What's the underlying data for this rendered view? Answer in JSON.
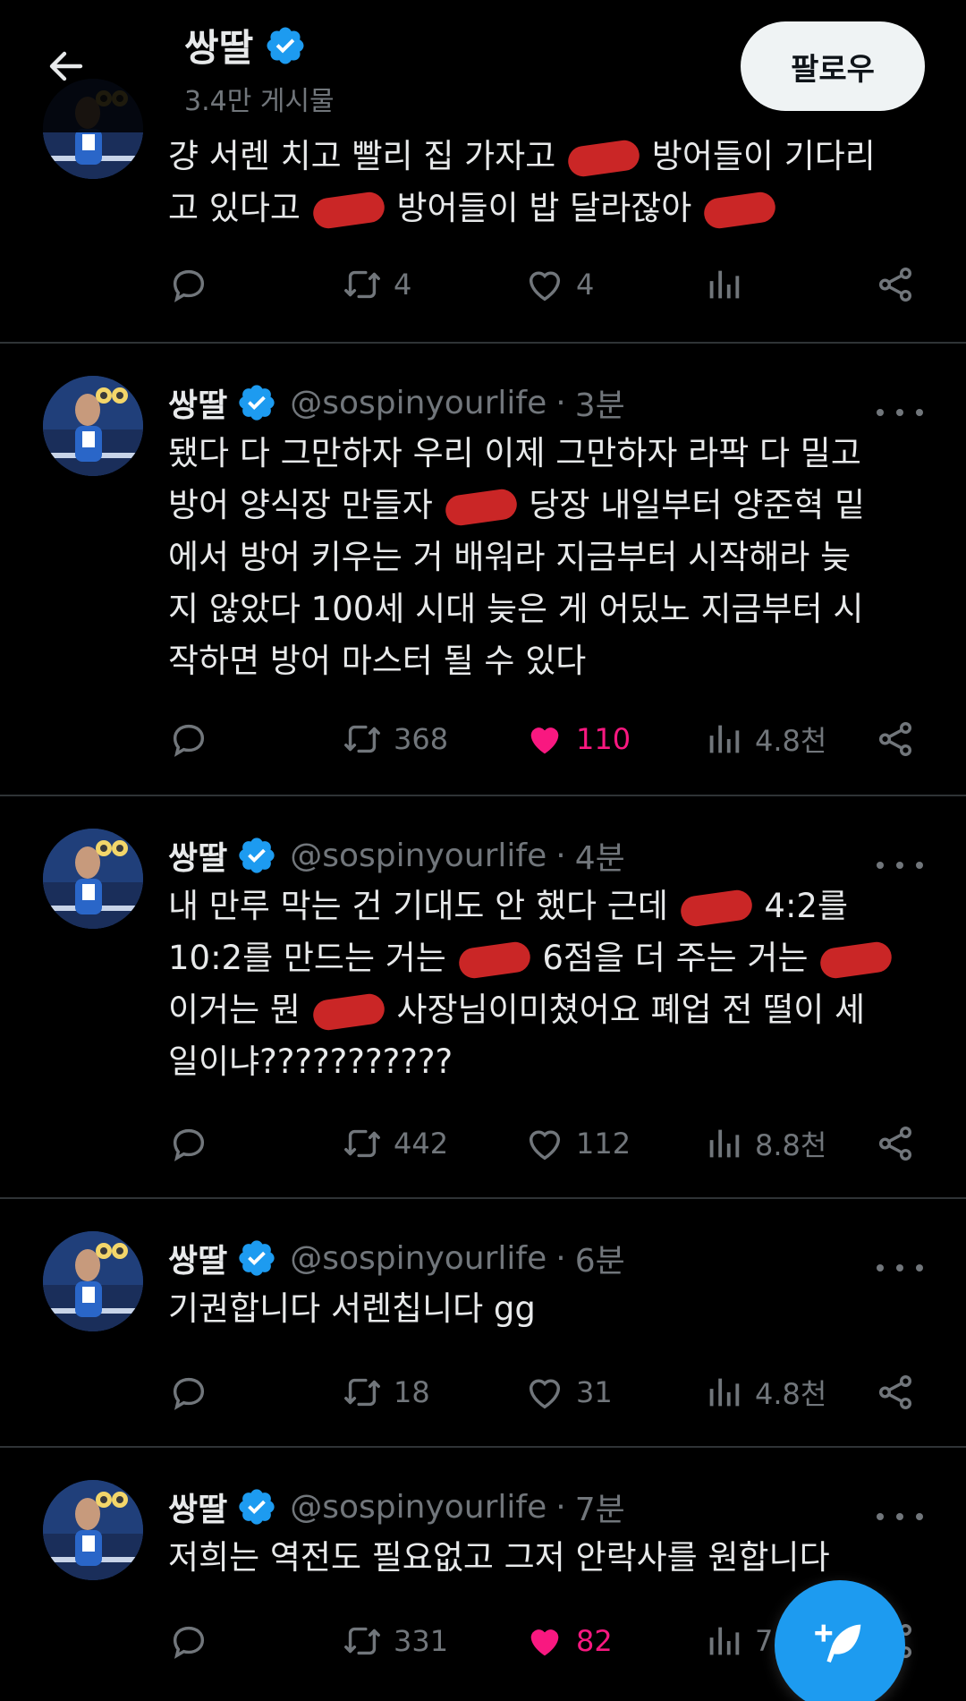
{
  "header": {
    "back_label": "←",
    "name": "쌍딸",
    "post_count": "3.4만 게시물",
    "follow_label": "팔로우"
  },
  "colors": {
    "background": "#000000",
    "verified": "#1d9bf0",
    "like_pink": "#f91880",
    "muted_text": "#71767b",
    "censor_red": "#e02a2a"
  },
  "tweets": [
    {
      "partial": true,
      "lines": [
        "걍 서렌 치고 빨리 집 가자고 ████ 방어들이 기다리",
        "고 있다고 ████ 방어들이 밥 달라잖아 ████"
      ],
      "replies": "",
      "retweets": "4",
      "likes": "4",
      "liked": false,
      "views": ""
    },
    {
      "name": "쌍딸",
      "handle": "@sospinyourlife",
      "time": "3분",
      "lines": [
        "됐다 다 그만하자 우리 이제 그만하자 라팍 다 밀고",
        "방어 양식장 만들자 ████ 당장 내일부터 양준혁 밑",
        "에서 방어 키우는 거 배워라 지금부터 시작해라 늦",
        "지 않았다 100세 시대 늦은 게 어딨노 지금부터 시",
        "작하면 방어 마스터 될 수 있다"
      ],
      "replies": "",
      "retweets": "368",
      "likes": "110",
      "liked": true,
      "views": "4.8천"
    },
    {
      "name": "쌍딸",
      "handle": "@sospinyourlife",
      "time": "4분",
      "lines": [
        "내 만루 막는 건 기대도 안 했다 근데 ████ 4:2를",
        "10:2를 만드는 거는 ████ 6점을 더 주는 거는 ████",
        "이거는 뭔 ████ 사장님이미쳤어요 폐업 전 떨이 세",
        "일이냐???????????"
      ],
      "replies": "",
      "retweets": "442",
      "likes": "112",
      "liked": false,
      "views": "8.8천"
    },
    {
      "name": "쌍딸",
      "handle": "@sospinyourlife",
      "time": "6분",
      "lines": [
        "기권합니다 서렌칩니다 gg"
      ],
      "replies": "",
      "retweets": "18",
      "likes": "31",
      "liked": false,
      "views": "4.8천"
    },
    {
      "name": "쌍딸",
      "handle": "@sospinyourlife",
      "time": "7분",
      "lines": [
        "저희는 역전도 필요없고 그저 안락사를 원합니다"
      ],
      "replies": "",
      "retweets": "331",
      "likes": "82",
      "liked": true,
      "views": "7."
    }
  ],
  "icons": {
    "back": "arrow-left-icon",
    "verified": "verified-badge-icon",
    "reply": "reply-icon",
    "retweet": "retweet-icon",
    "like": "heart-icon",
    "views": "views-icon",
    "share": "share-icon",
    "more": "more-icon",
    "compose": "compose-icon"
  }
}
